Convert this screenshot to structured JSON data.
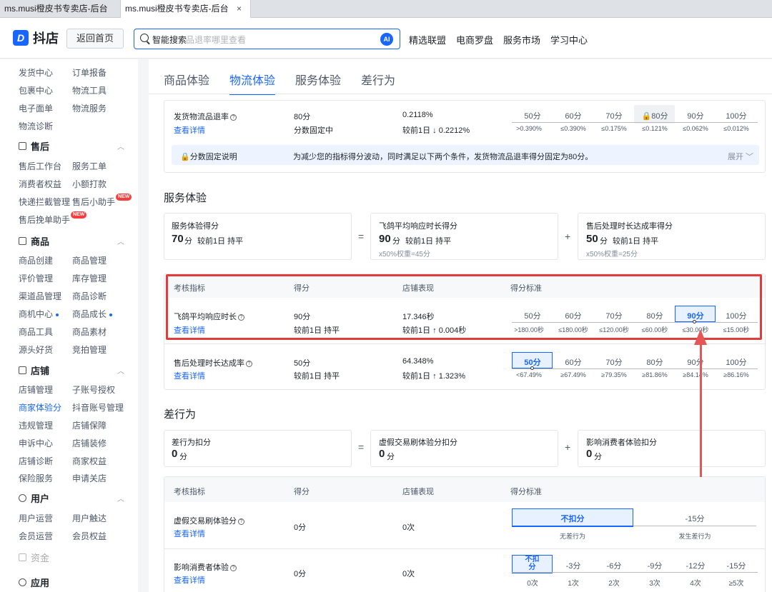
{
  "browser": {
    "tabs": [
      {
        "title": "ms.musi橙皮书专卖店-后台"
      },
      {
        "title": "ms.musi橙皮书专卖店-后台",
        "close": "×"
      }
    ]
  },
  "header": {
    "logo_text": "抖店",
    "logo_mark": "D",
    "home_button": "返回首页",
    "search_label": "智能搜索",
    "search_placeholder": "品退率哪里查看",
    "ai_badge": "AI",
    "nav": [
      "精选联盟",
      "电商罗盘",
      "服务市场",
      "学习中心"
    ]
  },
  "sidebar": {
    "top_partial": [
      "发货中心",
      "订单报备"
    ],
    "rows_top": [
      [
        "包裹中心",
        "物流工具"
      ],
      [
        "电子面单",
        "物流服务"
      ],
      [
        "物流诊断",
        ""
      ]
    ],
    "groups": [
      {
        "title": "售后",
        "rows": [
          [
            "售后工作台",
            "服务工单"
          ],
          [
            "消费者权益",
            "小额打款"
          ],
          [
            "快递拦截管理",
            "售后小助手"
          ],
          [
            "售后挽单助手",
            ""
          ]
        ]
      },
      {
        "title": "商品",
        "rows": [
          [
            "商品创建",
            "商品管理"
          ],
          [
            "评价管理",
            "库存管理"
          ],
          [
            "渠道品管理",
            "商品诊断"
          ],
          [
            "商机中心",
            "商品成长"
          ],
          [
            "商品工具",
            "商品素材"
          ],
          [
            "源头好货",
            "竞拍管理"
          ]
        ]
      },
      {
        "title": "店铺",
        "rows": [
          [
            "店铺管理",
            "子账号授权"
          ],
          [
            "商家体验分",
            "抖音账号管理"
          ],
          [
            "违规管理",
            "店铺保障"
          ],
          [
            "申诉中心",
            "店铺装修"
          ],
          [
            "店铺诊断",
            "商家权益"
          ],
          [
            "保险服务",
            "申请关店"
          ]
        ]
      },
      {
        "title": "用户",
        "rows": [
          [
            "用户运营",
            "用户触达"
          ],
          [
            "会员运营",
            "会员权益"
          ]
        ]
      }
    ],
    "new_badge": "NEW",
    "funds": "资金",
    "apps": "应用"
  },
  "main": {
    "tabs": [
      "商品体验",
      "物流体验",
      "服务体验",
      "差行为"
    ],
    "active_tab": "物流体验",
    "logistics": {
      "metric": "发货物流品退率",
      "detail": "查看详情",
      "score": "80分",
      "score_note": "分数固定中",
      "value": "0.2118%",
      "change": "较前1日 ↓ 0.2212%",
      "scale_top": [
        "50分",
        "60分",
        "70分",
        "80分",
        "90分",
        "100分"
      ],
      "scale_bot": [
        ">0.390%",
        "≤0.390%",
        "≤0.175%",
        "≤0.121%",
        "≤0.062%",
        "≤0.012%"
      ],
      "fixed_title": "分数固定说明",
      "fixed_text": "为减少您的指标得分波动，同时满足以下两个条件，发货物流品退率得分固定为80分。",
      "expand": "展开"
    },
    "service": {
      "section": "服务体验",
      "total_label": "服务体验得分",
      "total_value": "70",
      "total_unit": "分",
      "total_change": "较前1日 持平",
      "eq": "=",
      "plus": "+",
      "c1_label": "飞鸽平均响应时长得分",
      "c1_value": "90",
      "c1_unit": "分",
      "c1_change": "较前1日 持平",
      "c1_weight": "x50%权重=45分",
      "c2_label": "售后处理时长达成率得分",
      "c2_value": "50",
      "c2_unit": "分",
      "c2_change": "较前1日 持平",
      "c2_weight": "x50%权重=25分",
      "headers": [
        "考核指标",
        "得分",
        "店铺表现",
        "得分标准"
      ],
      "rows": [
        {
          "metric": "飞鸽平均响应时长",
          "detail": "查看详情",
          "score": "90分",
          "score_change": "较前1日 持平",
          "perf": "17.346秒",
          "perf_change": "较前1日 ↑ 0.004秒",
          "scale_top": [
            "50分",
            "60分",
            "70分",
            "80分",
            "90分",
            "100分"
          ],
          "scale_bot": [
            ">180.00秒",
            "≤180.00秒",
            "≤120.00秒",
            "≤60.00秒",
            "≤30.00秒",
            "≤15.00秒"
          ]
        },
        {
          "metric": "售后处理时长达成率",
          "detail": "查看详情",
          "score": "50分",
          "score_change": "较前1日 持平",
          "perf": "64.348%",
          "perf_change": "较前1日 ↑ 1.323%",
          "scale_top": [
            "50分",
            "60分",
            "70分",
            "80分",
            "90分",
            "100分"
          ],
          "scale_bot": [
            "<67.49%",
            "≥67.49%",
            "≥79.35%",
            "≥81.86%",
            "≥84.14%",
            "≥86.16%"
          ]
        }
      ]
    },
    "bad": {
      "section": "差行为",
      "total_label": "差行为扣分",
      "total_value": "0",
      "total_unit": "分",
      "c1_label": "虚假交易刷体验分扣分",
      "c1_value": "0",
      "c1_unit": "分",
      "c2_label": "影响消费者体验扣分",
      "c2_value": "0",
      "c2_unit": "分",
      "headers": [
        "考核指标",
        "得分",
        "店铺表现",
        "得分标准"
      ],
      "row1": {
        "metric": "虚假交易刷体验分",
        "detail": "查看详情",
        "score": "0分",
        "perf": "0次",
        "left": "不扣分",
        "left_sub": "无差行为",
        "right": "-15分",
        "right_sub": "发生差行为"
      },
      "row2": {
        "metric": "影响消费者体验",
        "detail": "查看详情",
        "score": "0分",
        "perf": "0次",
        "scale_top": [
          "不扣分",
          "-3分",
          "-6分",
          "-9分",
          "-12分",
          "-15分"
        ],
        "scale_bot": [
          "0次",
          "1次",
          "2次",
          "3次",
          "4次",
          "≥5次"
        ]
      }
    }
  },
  "colors": {
    "accent": "#1966ff",
    "annotation": "#e03c3c"
  }
}
